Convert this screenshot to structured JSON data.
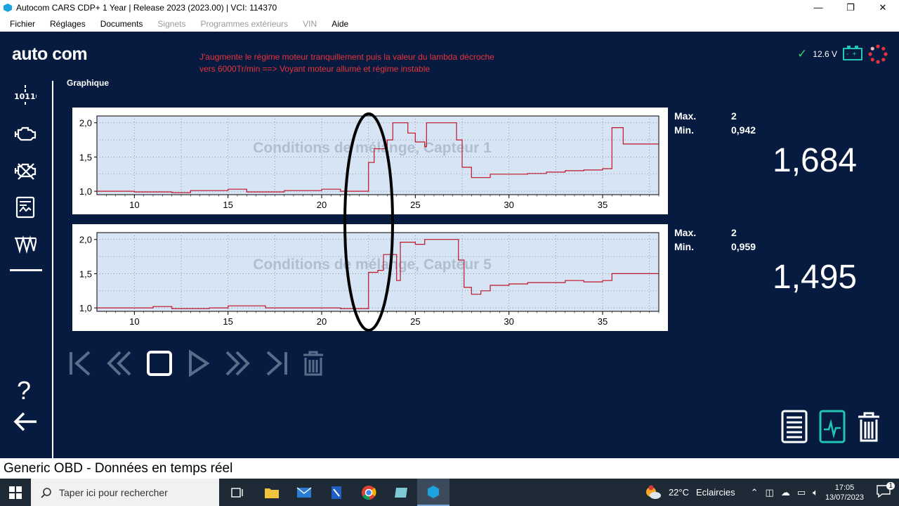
{
  "window": {
    "title": "Autocom CARS CDP+ 1 Year |  Release 2023 (2023.00)  |  VCI: 114370",
    "minimize": "—",
    "maximize": "❐",
    "close": "✕"
  },
  "menu": [
    {
      "label": "Fichier",
      "enabled": true
    },
    {
      "label": "Réglages",
      "enabled": true
    },
    {
      "label": "Documents",
      "enabled": true
    },
    {
      "label": "Signets",
      "enabled": false
    },
    {
      "label": "Programmes extérieurs",
      "enabled": false
    },
    {
      "label": "VIN",
      "enabled": false
    },
    {
      "label": "Aide",
      "enabled": true
    }
  ],
  "logo": "auto com",
  "annotation": {
    "line1": "J'augmente le régime moteur tranquillement puis la valeur du lambda décroche",
    "line2": "vers 6000Tr/min ==> Voyant moteur allumé et régime instable"
  },
  "status": {
    "voltage": "12.6 V",
    "battery_symbols": "-+"
  },
  "section_title": "Graphique",
  "sidebar_icons": [
    "binary-data-icon",
    "engine-icon",
    "engine-fault-icon",
    "ecu-icon",
    "oscilloscope-icon"
  ],
  "charts": [
    {
      "watermark": "Conditions de mélange, Capteur 1",
      "max_label": "Max.",
      "max_value": "2",
      "min_label": "Min.",
      "min_value": "0,942",
      "current": "1,684",
      "yticks": [
        "2,0",
        "1,5",
        "1,0"
      ],
      "xticks": [
        "10",
        "15",
        "20",
        "25",
        "30",
        "35"
      ],
      "points": [
        [
          8,
          1.0
        ],
        [
          10,
          0.99
        ],
        [
          12,
          0.98
        ],
        [
          13,
          1.01
        ],
        [
          15,
          1.03
        ],
        [
          16,
          0.99
        ],
        [
          18,
          1.01
        ],
        [
          20,
          1.03
        ],
        [
          21,
          1.0
        ],
        [
          22,
          1.0
        ],
        [
          22.5,
          1.42
        ],
        [
          22.8,
          1.62
        ],
        [
          23.5,
          1.75
        ],
        [
          23.8,
          2.0
        ],
        [
          24.5,
          2.0
        ],
        [
          24.6,
          1.85
        ],
        [
          25,
          1.72
        ],
        [
          25.5,
          1.65
        ],
        [
          25.6,
          2.0
        ],
        [
          27,
          2.0
        ],
        [
          27.2,
          1.75
        ],
        [
          27.5,
          1.35
        ],
        [
          28,
          1.2
        ],
        [
          28.5,
          1.2
        ],
        [
          29,
          1.25
        ],
        [
          30,
          1.25
        ],
        [
          31,
          1.26
        ],
        [
          32,
          1.28
        ],
        [
          33,
          1.3
        ],
        [
          34,
          1.31
        ],
        [
          35,
          1.33
        ],
        [
          35.4,
          1.33
        ],
        [
          35.5,
          1.93
        ],
        [
          36,
          1.93
        ],
        [
          36.1,
          1.69
        ],
        [
          38,
          1.69
        ]
      ]
    },
    {
      "watermark": "Conditions de mélange, Capteur 5",
      "max_label": "Max.",
      "max_value": "2",
      "min_label": "Min.",
      "min_value": "0,959",
      "current": "1,495",
      "yticks": [
        "2,0",
        "1,5",
        "1,0"
      ],
      "xticks": [
        "10",
        "15",
        "20",
        "25",
        "30",
        "35"
      ],
      "points": [
        [
          8,
          1.0
        ],
        [
          10,
          1.0
        ],
        [
          11,
          1.02
        ],
        [
          12,
          0.99
        ],
        [
          14,
          1.0
        ],
        [
          15,
          1.03
        ],
        [
          17,
          1.0
        ],
        [
          19,
          1.0
        ],
        [
          21,
          0.99
        ],
        [
          22,
          0.99
        ],
        [
          22.5,
          1.52
        ],
        [
          23,
          1.55
        ],
        [
          23.3,
          1.78
        ],
        [
          23.8,
          1.78
        ],
        [
          24,
          1.4
        ],
        [
          24.2,
          1.96
        ],
        [
          25,
          1.93
        ],
        [
          25.5,
          2.0
        ],
        [
          27,
          2.0
        ],
        [
          27.3,
          1.7
        ],
        [
          27.6,
          1.3
        ],
        [
          28,
          1.2
        ],
        [
          28.5,
          1.25
        ],
        [
          29,
          1.33
        ],
        [
          30,
          1.35
        ],
        [
          31,
          1.37
        ],
        [
          32,
          1.37
        ],
        [
          33,
          1.4
        ],
        [
          34,
          1.38
        ],
        [
          35,
          1.4
        ],
        [
          35.5,
          1.5
        ],
        [
          38,
          1.5
        ]
      ]
    }
  ],
  "controls": [
    "skip-start-icon",
    "rewind-icon",
    "stop-icon",
    "play-icon",
    "fast-forward-icon",
    "skip-end-icon",
    "trash-icon"
  ],
  "footer": "Generic OBD - Données en temps réel",
  "taskbar": {
    "search_placeholder": "Taper ici pour rechercher",
    "weather_temp": "22°C",
    "weather_text": "Eclaircies",
    "time": "17:05",
    "date": "13/07/2023",
    "notif_count": "1"
  }
}
